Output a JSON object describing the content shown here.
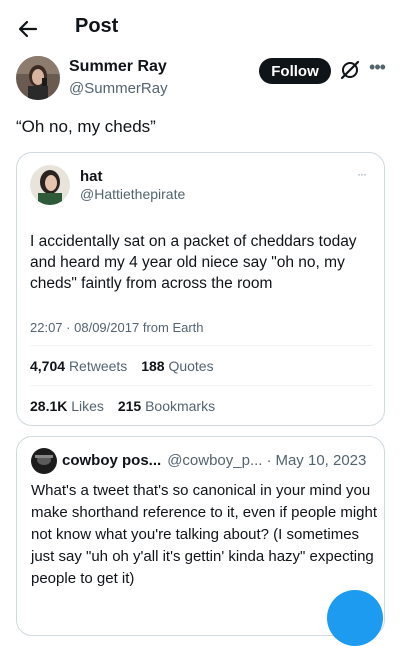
{
  "header": {
    "title": "Post",
    "back_icon": "arrow-left-icon"
  },
  "post": {
    "author_name": "Summer Ray",
    "author_handle": "@SummerRay",
    "follow_label": "Follow",
    "text": "“Oh no, my cheds”"
  },
  "quote": {
    "name": "hat",
    "handle": "@Hattiethepirate",
    "more": "···",
    "text": "I accidentally sat on a packet of cheddars today and heard my 4 year old niece say \"oh no, my cheds\" faintly from across the room",
    "time": "22:07",
    "date": "08/09/2017",
    "source": "from Earth",
    "retweets_count": "4,704",
    "retweets_label": "Retweets",
    "quotes_count": "188",
    "quotes_label": "Quotes",
    "likes_count": "28.1K",
    "likes_label": "Likes",
    "bookmarks_count": "215",
    "bookmarks_label": "Bookmarks"
  },
  "second_quote": {
    "name": "cowboy pos...",
    "handle": "@cowboy_p...",
    "date": "May 10, 2023",
    "text": "What's a tweet that's so canonical in your mind you make shorthand reference to it, even if people might not know what you're talking about? (I sometimes just say \"uh oh y'all it's gettin' kinda hazy\" expecting people to get it)"
  },
  "colors": {
    "text": "#0f1419",
    "secondary": "#536471",
    "border": "#cfd9de",
    "accent": "#1d9bf0"
  }
}
